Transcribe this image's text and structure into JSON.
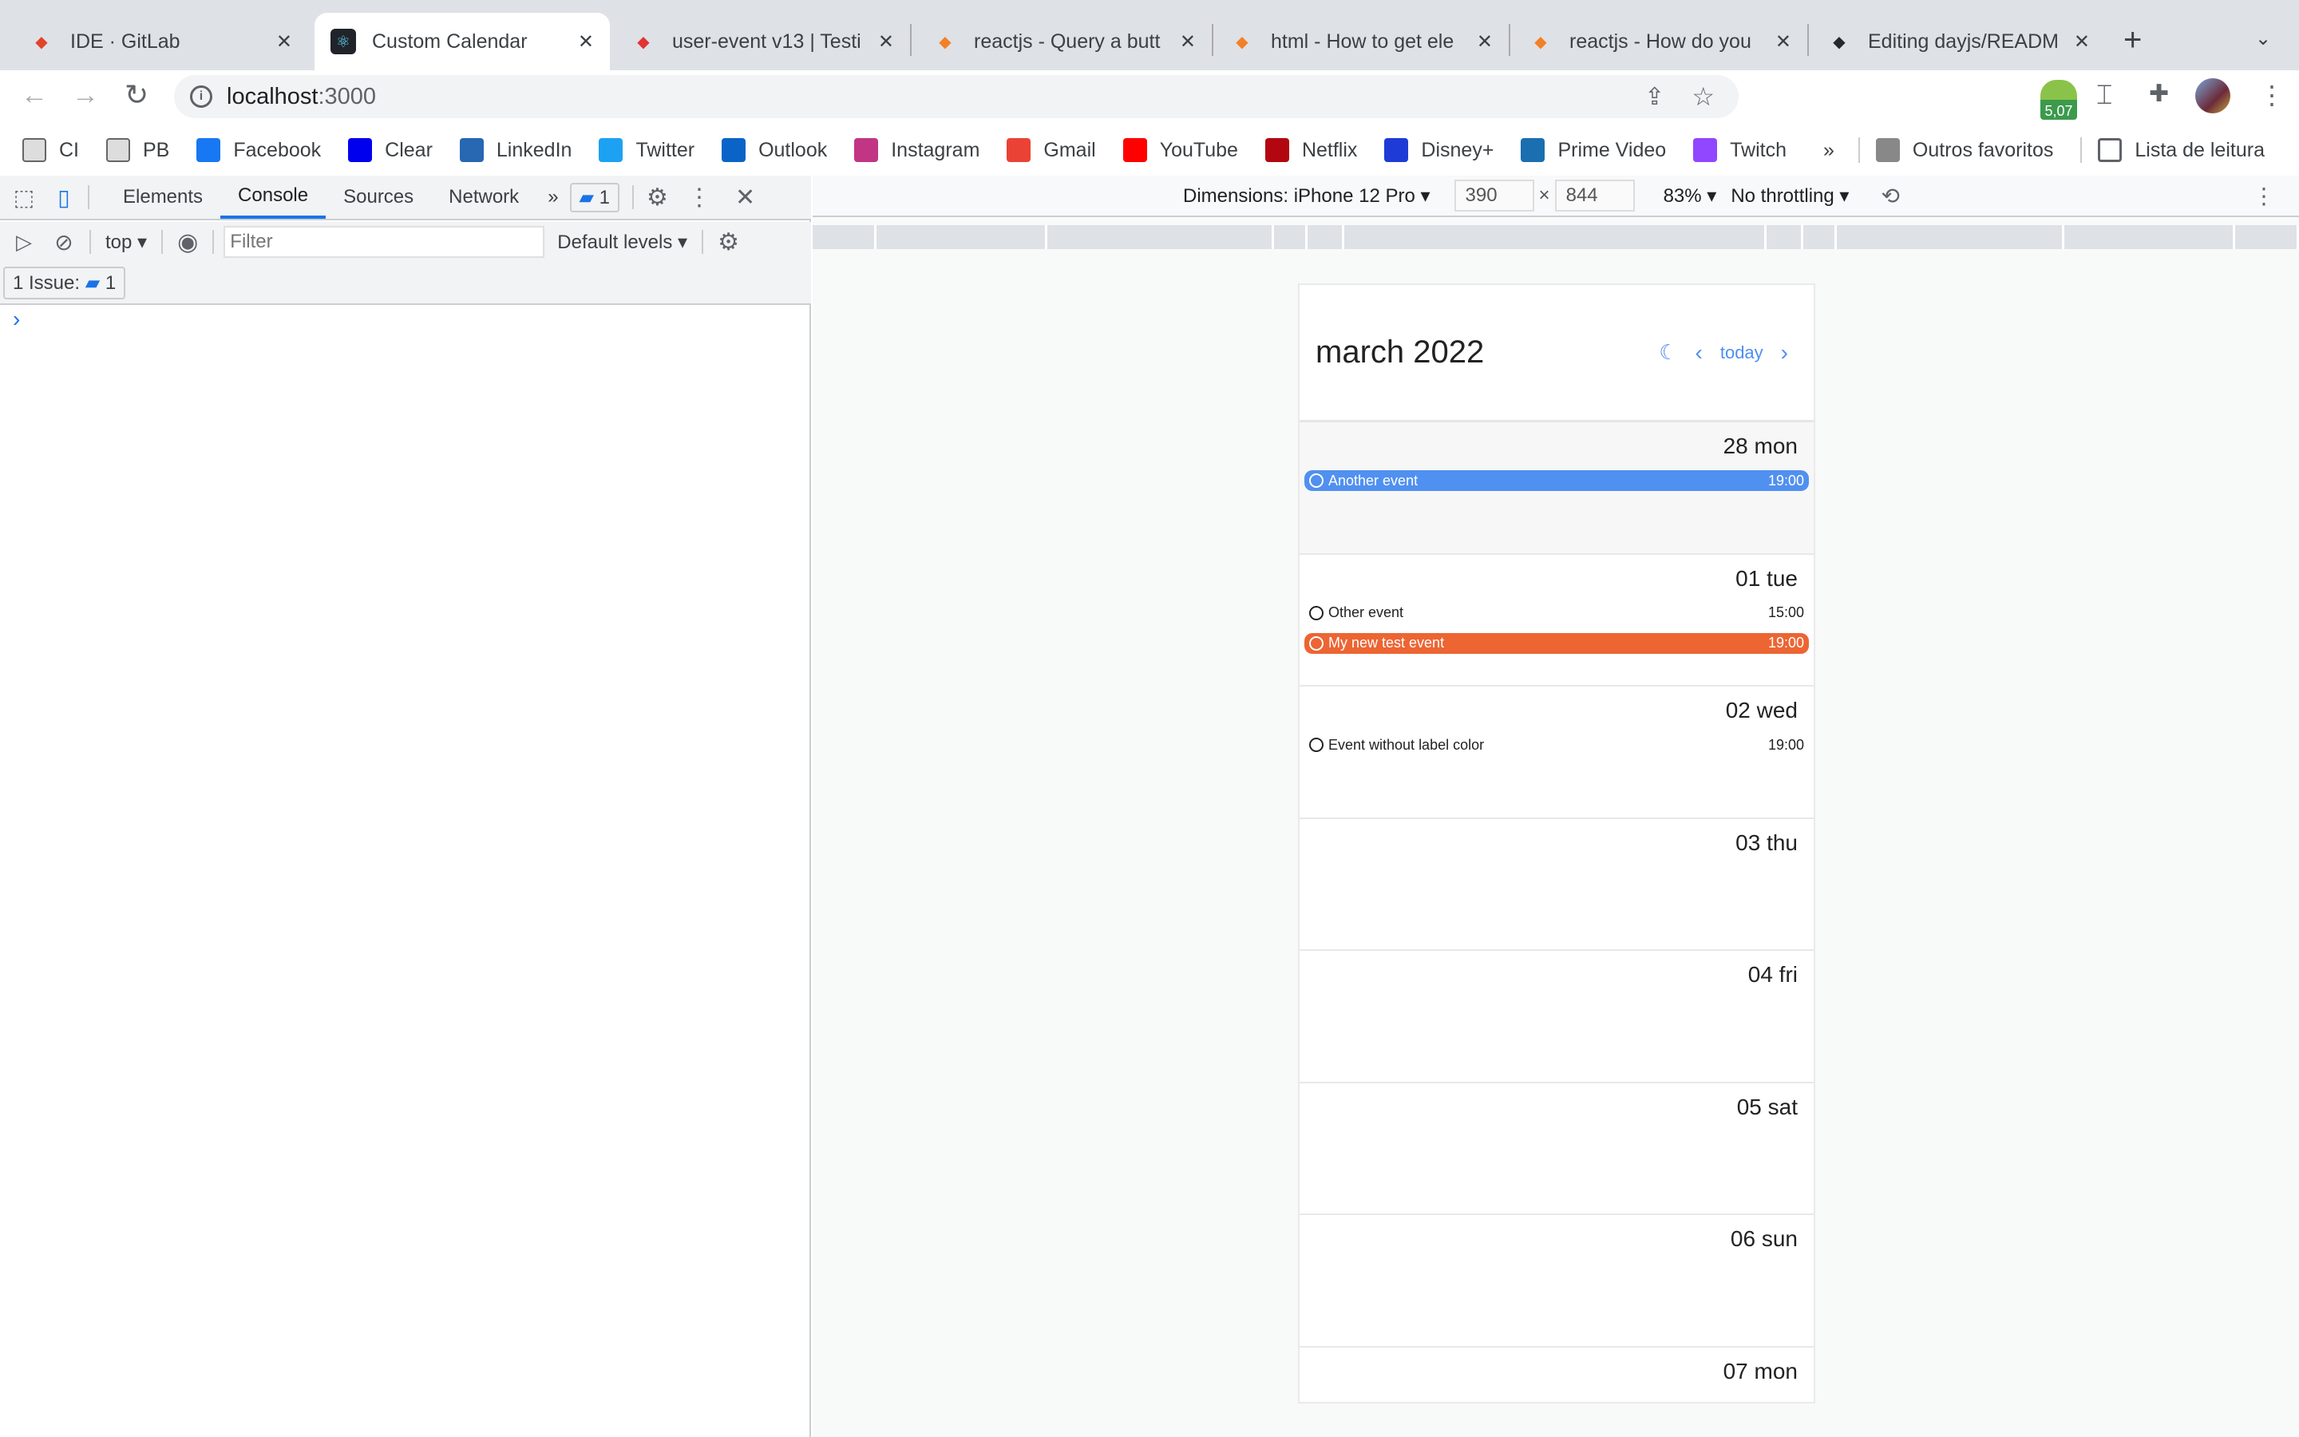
{
  "browser": {
    "tabs": [
      {
        "title": "IDE · GitLab",
        "icon": "gitlab-icon",
        "color": "#e24329",
        "active": false
      },
      {
        "title": "Custom Calendar",
        "icon": "react-icon",
        "color": "#20232a",
        "active": true
      },
      {
        "title": "user-event v13 | Testi",
        "icon": "octopus-icon",
        "color": "#e33332",
        "active": false
      },
      {
        "title": "reactjs - Query a butt",
        "icon": "stackoverflow-icon",
        "color": "#f48024",
        "active": false
      },
      {
        "title": "html - How to get ele",
        "icon": "stackoverflow-icon",
        "color": "#f48024",
        "active": false
      },
      {
        "title": "reactjs - How do you",
        "icon": "stackoverflow-icon",
        "color": "#f48024",
        "active": false
      },
      {
        "title": "Editing dayjs/READM",
        "icon": "github-icon",
        "color": "#24292e",
        "active": false
      }
    ],
    "url_host": "localhost",
    "url_port": ":3000",
    "extension_badge": "5,07",
    "bookmarks": [
      {
        "label": "CI",
        "icon": "folder-icon",
        "color": "#777"
      },
      {
        "label": "PB",
        "icon": "folder-icon",
        "color": "#777"
      },
      {
        "label": "Facebook",
        "icon": "facebook-icon",
        "color": "#1877f2"
      },
      {
        "label": "Clear",
        "icon": "clear-icon",
        "color": "#0000ee"
      },
      {
        "label": "LinkedIn",
        "icon": "linkedin-icon",
        "color": "#2867b2"
      },
      {
        "label": "Twitter",
        "icon": "twitter-icon",
        "color": "#1da1f2"
      },
      {
        "label": "Outlook",
        "icon": "outlook-icon",
        "color": "#0a64c8"
      },
      {
        "label": "Instagram",
        "icon": "instagram-icon",
        "color": "#c13584"
      },
      {
        "label": "Gmail",
        "icon": "gmail-icon",
        "color": "#ea4335"
      },
      {
        "label": "YouTube",
        "icon": "youtube-icon",
        "color": "#ff0000"
      },
      {
        "label": "Netflix",
        "icon": "netflix-icon",
        "color": "#b20710"
      },
      {
        "label": "Disney+",
        "icon": "disney-icon",
        "color": "#1f3bd6"
      },
      {
        "label": "Prime Video",
        "icon": "prime-video-icon",
        "color": "#1a6fb0"
      },
      {
        "label": "Twitch",
        "icon": "twitch-icon",
        "color": "#9146ff"
      }
    ],
    "bookmarks_more": "»",
    "other_bookmarks": "Outros favoritos",
    "reading_list": "Lista de leitura"
  },
  "devtools": {
    "tabs": [
      "Elements",
      "Console",
      "Sources",
      "Network"
    ],
    "active_tab": "Console",
    "more": "»",
    "issues_count": "1",
    "context": "top",
    "filter_placeholder": "Filter",
    "levels": "Default levels",
    "issue_label": "1 Issue:",
    "issue_count": "1",
    "prompt": "›"
  },
  "device": {
    "dimensions_label": "Dimensions: iPhone 12 Pro",
    "width": "390",
    "times": "×",
    "height": "844",
    "zoom": "83%",
    "throttling": "No throttling"
  },
  "calendar": {
    "title": "march 2022",
    "today_label": "today",
    "accent": "#4f8ef2",
    "days": [
      {
        "label": "28 mon",
        "outside": true,
        "events": [
          {
            "title": "Another event",
            "time": "19:00",
            "color": "#5090f0"
          }
        ]
      },
      {
        "label": "01 tue",
        "outside": false,
        "events": [
          {
            "title": "Other event",
            "time": "15:00",
            "color": null
          },
          {
            "title": "My new test event",
            "time": "19:00",
            "color": "#ec6533"
          }
        ]
      },
      {
        "label": "02 wed",
        "outside": false,
        "events": [
          {
            "title": "Event without label color",
            "time": "19:00",
            "color": null
          }
        ]
      },
      {
        "label": "03 thu",
        "outside": false,
        "events": []
      },
      {
        "label": "04 fri",
        "outside": false,
        "events": []
      },
      {
        "label": "05 sat",
        "outside": false,
        "events": []
      },
      {
        "label": "06 sun",
        "outside": false,
        "events": []
      },
      {
        "label": "07 mon",
        "outside": false,
        "events": []
      }
    ]
  }
}
